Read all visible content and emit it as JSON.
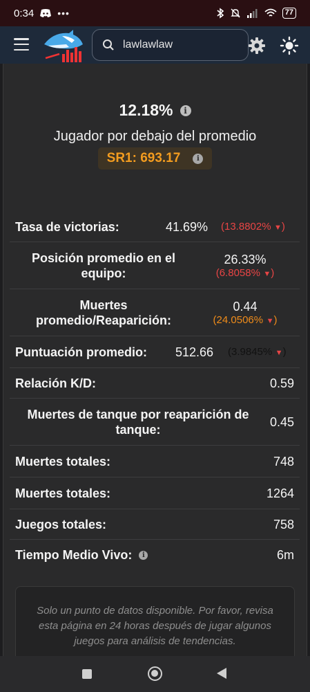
{
  "status": {
    "time": "0:34",
    "battery": "77"
  },
  "search": {
    "value": "lawlawlaw"
  },
  "summary": {
    "percent": "12.18%",
    "subtitle": "Jugador por debajo del promedio",
    "sr": "SR1: 693.17"
  },
  "stats": {
    "win_rate": {
      "label": "Tasa de victorias:",
      "value": "41.69%",
      "delta": "(13.8802%",
      "close": ")"
    },
    "team_pos": {
      "label1": "Posición promedio en el",
      "label2": "equipo:",
      "value": "26.33%",
      "delta": "(6.8058%",
      "close": ")"
    },
    "deaths_resp": {
      "label1": "Muertes",
      "label2": "promedio/Reaparición:",
      "value": "0.44",
      "delta": "(24.0506%",
      "close": ")"
    },
    "avg_score": {
      "label": "Puntuación promedio:",
      "value": "512.66",
      "delta": "(3.9845%",
      "close": ")"
    },
    "kd": {
      "label": "Relación K/D:",
      "value": "0.59"
    },
    "tank": {
      "label1": "Muertes de tanque por reaparición de",
      "label2": "tanque:",
      "value": "0.45"
    },
    "total_deaths": {
      "label": "Muertes totales:",
      "value": "748"
    },
    "total_kills": {
      "label": "Muertes totales:",
      "value": "1264"
    },
    "total_games": {
      "label": "Juegos totales:",
      "value": "758"
    },
    "avg_alive": {
      "label": "Tiempo Medio Vivo:",
      "value": "6m"
    }
  },
  "notice": {
    "text": "Solo un punto de datos disponible. Por favor, revisa esta página en 24 horas después de jugar algunos juegos para análisis de tendencias."
  }
}
